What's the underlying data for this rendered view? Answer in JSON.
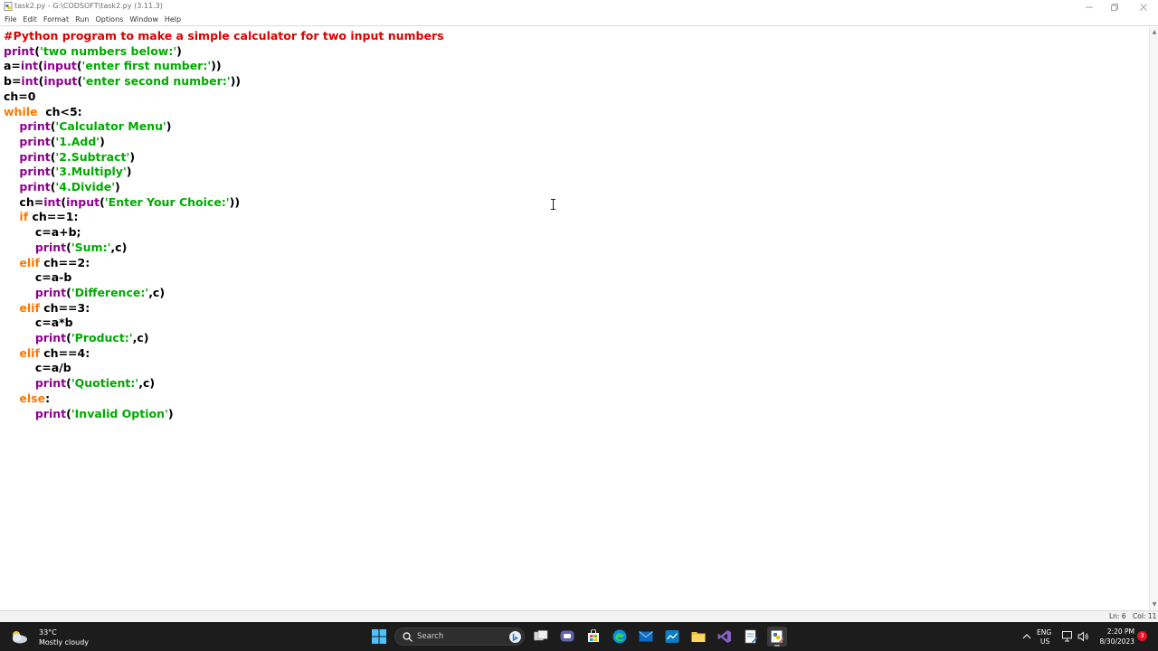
{
  "window": {
    "title": "task2.py - G:\\CODSOFT\\task2.py (3.11.3)",
    "controls": [
      "minimize",
      "maximize",
      "close"
    ]
  },
  "menu": [
    "File",
    "Edit",
    "Format",
    "Run",
    "Options",
    "Window",
    "Help"
  ],
  "code": {
    "lines": [
      [
        {
          "t": "#Python program to make a simple calculator for two input numbers",
          "c": "cm"
        }
      ],
      [
        {
          "t": "print",
          "c": "bi"
        },
        {
          "t": "(",
          "c": ""
        },
        {
          "t": "'two numbers below:'",
          "c": "st"
        },
        {
          "t": ")",
          "c": ""
        }
      ],
      [
        {
          "t": "a=",
          "c": ""
        },
        {
          "t": "int",
          "c": "bi"
        },
        {
          "t": "(",
          "c": ""
        },
        {
          "t": "input",
          "c": "bi"
        },
        {
          "t": "(",
          "c": ""
        },
        {
          "t": "'enter first number:'",
          "c": "st"
        },
        {
          "t": "))",
          "c": ""
        }
      ],
      [
        {
          "t": "b=",
          "c": ""
        },
        {
          "t": "int",
          "c": "bi"
        },
        {
          "t": "(",
          "c": ""
        },
        {
          "t": "input",
          "c": "bi"
        },
        {
          "t": "(",
          "c": ""
        },
        {
          "t": "'enter second number:'",
          "c": "st"
        },
        {
          "t": "))",
          "c": ""
        }
      ],
      [
        {
          "t": "ch=0",
          "c": ""
        }
      ],
      [
        {
          "t": "while",
          "c": "kw"
        },
        {
          "t": "  ch<5:",
          "c": ""
        }
      ],
      [
        {
          "t": "    ",
          "c": ""
        },
        {
          "t": "print",
          "c": "bi"
        },
        {
          "t": "(",
          "c": ""
        },
        {
          "t": "'Calculator Menu'",
          "c": "st"
        },
        {
          "t": ")",
          "c": ""
        }
      ],
      [
        {
          "t": "    ",
          "c": ""
        },
        {
          "t": "print",
          "c": "bi"
        },
        {
          "t": "(",
          "c": ""
        },
        {
          "t": "'1.Add'",
          "c": "st"
        },
        {
          "t": ")",
          "c": ""
        }
      ],
      [
        {
          "t": "    ",
          "c": ""
        },
        {
          "t": "print",
          "c": "bi"
        },
        {
          "t": "(",
          "c": ""
        },
        {
          "t": "'2.Subtract'",
          "c": "st"
        },
        {
          "t": ")",
          "c": ""
        }
      ],
      [
        {
          "t": "    ",
          "c": ""
        },
        {
          "t": "print",
          "c": "bi"
        },
        {
          "t": "(",
          "c": ""
        },
        {
          "t": "'3.Multiply'",
          "c": "st"
        },
        {
          "t": ")",
          "c": ""
        }
      ],
      [
        {
          "t": "    ",
          "c": ""
        },
        {
          "t": "print",
          "c": "bi"
        },
        {
          "t": "(",
          "c": ""
        },
        {
          "t": "'4.Divide'",
          "c": "st"
        },
        {
          "t": ")",
          "c": ""
        }
      ],
      [
        {
          "t": "    ch=",
          "c": ""
        },
        {
          "t": "int",
          "c": "bi"
        },
        {
          "t": "(",
          "c": ""
        },
        {
          "t": "input",
          "c": "bi"
        },
        {
          "t": "(",
          "c": ""
        },
        {
          "t": "'Enter Your Choice:'",
          "c": "st"
        },
        {
          "t": "))",
          "c": ""
        }
      ],
      [
        {
          "t": "    ",
          "c": ""
        },
        {
          "t": "if",
          "c": "kw"
        },
        {
          "t": " ch==1:",
          "c": ""
        }
      ],
      [
        {
          "t": "        c=a+b;",
          "c": ""
        }
      ],
      [
        {
          "t": "        ",
          "c": ""
        },
        {
          "t": "print",
          "c": "bi"
        },
        {
          "t": "(",
          "c": ""
        },
        {
          "t": "'Sum:'",
          "c": "st"
        },
        {
          "t": ",c)",
          "c": ""
        }
      ],
      [
        {
          "t": "    ",
          "c": ""
        },
        {
          "t": "elif",
          "c": "kw"
        },
        {
          "t": " ch==2:",
          "c": ""
        }
      ],
      [
        {
          "t": "        c=a-b",
          "c": ""
        }
      ],
      [
        {
          "t": "        ",
          "c": ""
        },
        {
          "t": "print",
          "c": "bi"
        },
        {
          "t": "(",
          "c": ""
        },
        {
          "t": "'Difference:'",
          "c": "st"
        },
        {
          "t": ",c)",
          "c": ""
        }
      ],
      [
        {
          "t": "    ",
          "c": ""
        },
        {
          "t": "elif",
          "c": "kw"
        },
        {
          "t": " ch==3:",
          "c": ""
        }
      ],
      [
        {
          "t": "        c=a*b",
          "c": ""
        }
      ],
      [
        {
          "t": "        ",
          "c": ""
        },
        {
          "t": "print",
          "c": "bi"
        },
        {
          "t": "(",
          "c": ""
        },
        {
          "t": "'Product:'",
          "c": "st"
        },
        {
          "t": ",c)",
          "c": ""
        }
      ],
      [
        {
          "t": "    ",
          "c": ""
        },
        {
          "t": "elif",
          "c": "kw"
        },
        {
          "t": " ch==4:",
          "c": ""
        }
      ],
      [
        {
          "t": "        c=a/b",
          "c": ""
        }
      ],
      [
        {
          "t": "        ",
          "c": ""
        },
        {
          "t": "print",
          "c": "bi"
        },
        {
          "t": "(",
          "c": ""
        },
        {
          "t": "'Quotient:'",
          "c": "st"
        },
        {
          "t": ",c)",
          "c": ""
        }
      ],
      [
        {
          "t": "    ",
          "c": ""
        },
        {
          "t": "else",
          "c": "kw"
        },
        {
          "t": ":",
          "c": ""
        }
      ],
      [
        {
          "t": "        ",
          "c": ""
        },
        {
          "t": "print",
          "c": "bi"
        },
        {
          "t": "(",
          "c": ""
        },
        {
          "t": "'Invalid Option'",
          "c": "st"
        },
        {
          "t": ")",
          "c": ""
        }
      ]
    ]
  },
  "status": {
    "line": "Ln: 6",
    "col": "Col: 11"
  },
  "taskbar": {
    "weather": {
      "temp": "33°C",
      "condition": "Mostly cloudy"
    },
    "search_label": "Search",
    "language": {
      "lang": "ENG",
      "region": "US"
    },
    "clock": {
      "time": "2:20 PM",
      "date": "8/30/2023"
    },
    "notification_count": "3",
    "apps": [
      "start-icon",
      "search-icon",
      "bing-icon",
      "task-view-icon",
      "teams-chat-icon",
      "store-icon",
      "edge-icon",
      "mail-icon",
      "stock-icon",
      "file-explorer-icon",
      "visual-studio-icon",
      "notepad-icon",
      "idle-icon"
    ]
  },
  "colors": {
    "keyword": "#ff7700",
    "builtin": "#900090",
    "string": "#00aa00",
    "comment": "#dd0000",
    "taskbar": "#1c1c1c"
  }
}
